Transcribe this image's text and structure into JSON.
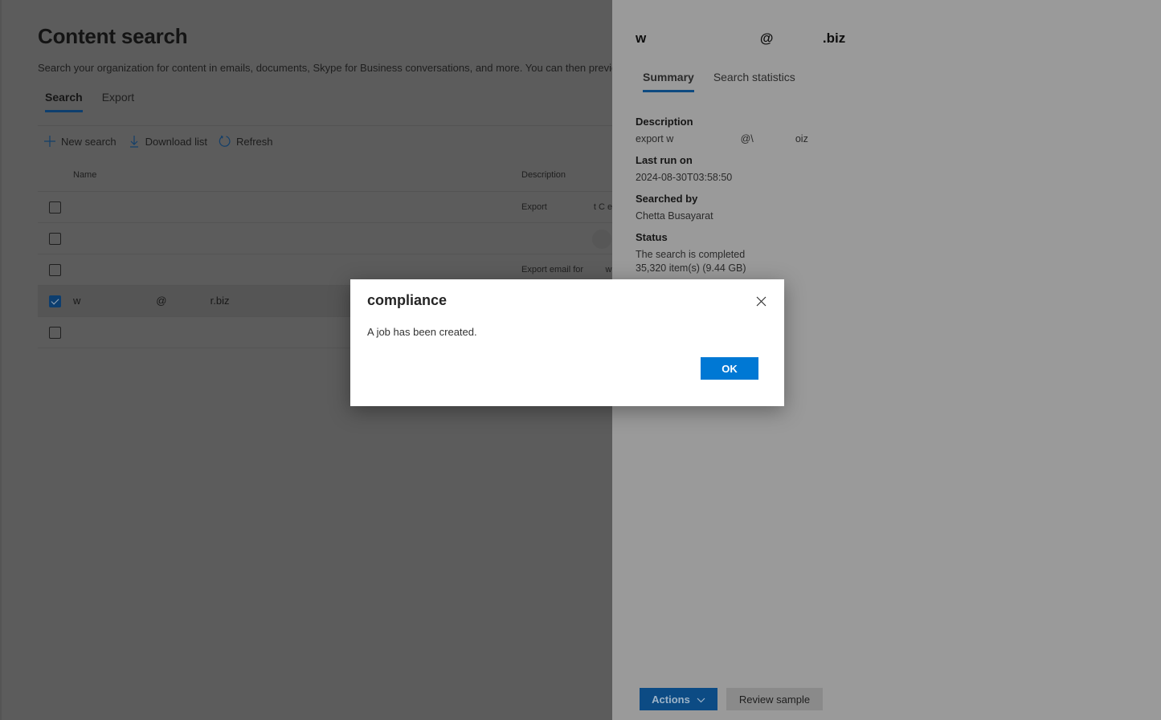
{
  "main": {
    "title": "Content search",
    "description": "Search your organization for content in emails, documents, Skype for Business conversations, and more. You can then preview and",
    "tabs": [
      {
        "label": "Search",
        "active": true
      },
      {
        "label": "Export",
        "active": false
      }
    ],
    "toolbar": {
      "new_search": "New search",
      "download_list": "Download list",
      "refresh": "Refresh"
    },
    "grid": {
      "columns": {
        "name": "Name",
        "description": "Description"
      },
      "rows": [
        {
          "name": "",
          "description": "Export                   t C em",
          "checked": false
        },
        {
          "name": "",
          "description": "",
          "checked": false
        },
        {
          "name": "",
          "description": "Export email for         wa",
          "checked": false
        },
        {
          "name": "w                          @               r.biz",
          "description": "",
          "checked": true
        },
        {
          "name": "",
          "description": "",
          "checked": false
        }
      ]
    }
  },
  "panel": {
    "title": "w                              @             .biz",
    "tabs": [
      {
        "label": "Summary",
        "active": true
      },
      {
        "label": "Search statistics",
        "active": false
      }
    ],
    "fields": [
      {
        "label": "Description",
        "value": "export w                        @\\               oiz"
      },
      {
        "label": "Last run on",
        "value": "2024-08-30T03:58:50"
      },
      {
        "label": "Searched by",
        "value": "Chetta Busayarat"
      },
      {
        "label": "Status",
        "value": "The search is completed\n35,320 item(s) (9.44 GB)"
      }
    ],
    "actions_label": "Actions",
    "review_label": "Review sample"
  },
  "dialog": {
    "title": "compliance",
    "message": "A job has been created.",
    "ok_label": "OK"
  },
  "colors": {
    "accent": "#0078d4",
    "overlay_main": "#5c5c5c",
    "overlay_panel": "#9a9a9a"
  }
}
